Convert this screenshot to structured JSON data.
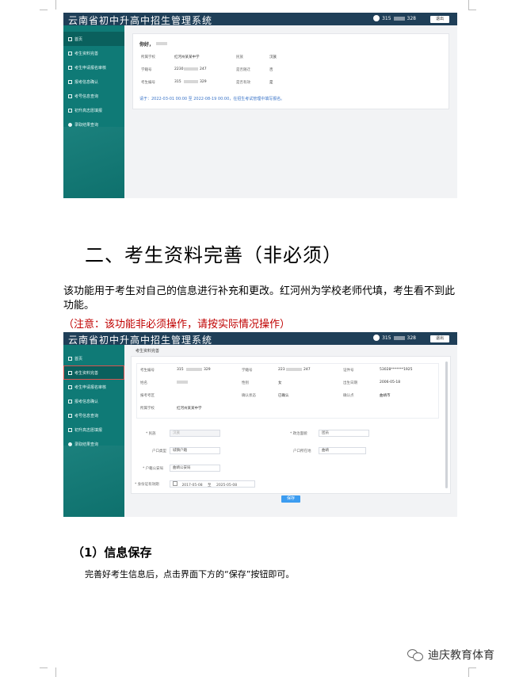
{
  "shot1": {
    "system_title": "云南省初中升高中招生管理系统",
    "user_prefix": "315",
    "user_suffix": "328",
    "logout": "退出",
    "sidebar": [
      "首页",
      "考生资料完善",
      "考生申请报名审核",
      "报考信息确认",
      "考号信息查询",
      "初升高志愿填报",
      "录取结果查询"
    ],
    "greeting": "你好，",
    "rows": [
      {
        "l1": "所属学校",
        "v1": "红河州某某中学",
        "l2": "民族",
        "v2": "汉族"
      },
      {
        "l1": "学籍号",
        "v1": "2230",
        "v1b": "247",
        "l2": "是否随迁",
        "v2": "否"
      },
      {
        "l1": "考生编号",
        "v1": "315",
        "v1b": "329",
        "l2": "是否有效",
        "v2": "是"
      }
    ],
    "notice": "请于：2022-03-01 00:00 至 2022-08-19 00:00，在招生考试管理中填写报名。"
  },
  "heading": "二、考生资料完善（非必须）",
  "para": "该功能用于考生对自己的信息进行补充和更改。红河州为学校老师代填，考生看不到此功能。",
  "note": "（注意：该功能非必须操作，请按实际情况操作）",
  "shot2": {
    "system_title": "云南省初中升高中招生管理系统",
    "user_prefix": "315",
    "user_suffix": "328",
    "logout": "退出",
    "sidebar": [
      "首页",
      "考生资料完善",
      "考生申请报名审核",
      "报考信息确认",
      "考号信息查询",
      "初升高志愿填报",
      "录取结果查询"
    ],
    "tab": "考生资料完善",
    "info": [
      {
        "l1": "考生编号",
        "v1": "315",
        "v1b": "329",
        "l2": "学籍号",
        "v2": "223",
        "v2b": "247",
        "l3": "证件号",
        "v3": "53028*******1925"
      },
      {
        "l1": "姓名",
        "v1": "",
        "l2": "性别",
        "v2": "女",
        "l3": "出生日期",
        "v3": "2006-05-18"
      },
      {
        "l1": "报考考区",
        "v1": "",
        "l2": "确认状态",
        "v2": "已确认",
        "l3": "确认点",
        "v3": "曲靖市"
      },
      {
        "l1": "所属学校",
        "v1": "红河州某某中学",
        "l2": "",
        "v2": "",
        "l3": "",
        "v3": ""
      }
    ],
    "form": {
      "ethnic_label": "* 民族",
      "ethnic_value": "汉族",
      "politic_label": "* 政治面貌",
      "politic_value": "团员",
      "hukou_type_label": "户口类型",
      "hukou_type_value": "城镇户籍",
      "hukou_place_label": "户口所在地",
      "hukou_place_value": "曲靖",
      "police_label": "* 户籍公安局",
      "police_value": "曲靖公安局",
      "id_period_label": "* 身份证有效期",
      "id_start": "2017-05-08",
      "id_sep": "至",
      "id_end": "2025-05-08"
    },
    "save": "保存"
  },
  "h3": "（1）信息保存",
  "p2": "完善好考生信息后，点击界面下方的“保存”按钮即可。",
  "brand": "迪庆教育体育"
}
